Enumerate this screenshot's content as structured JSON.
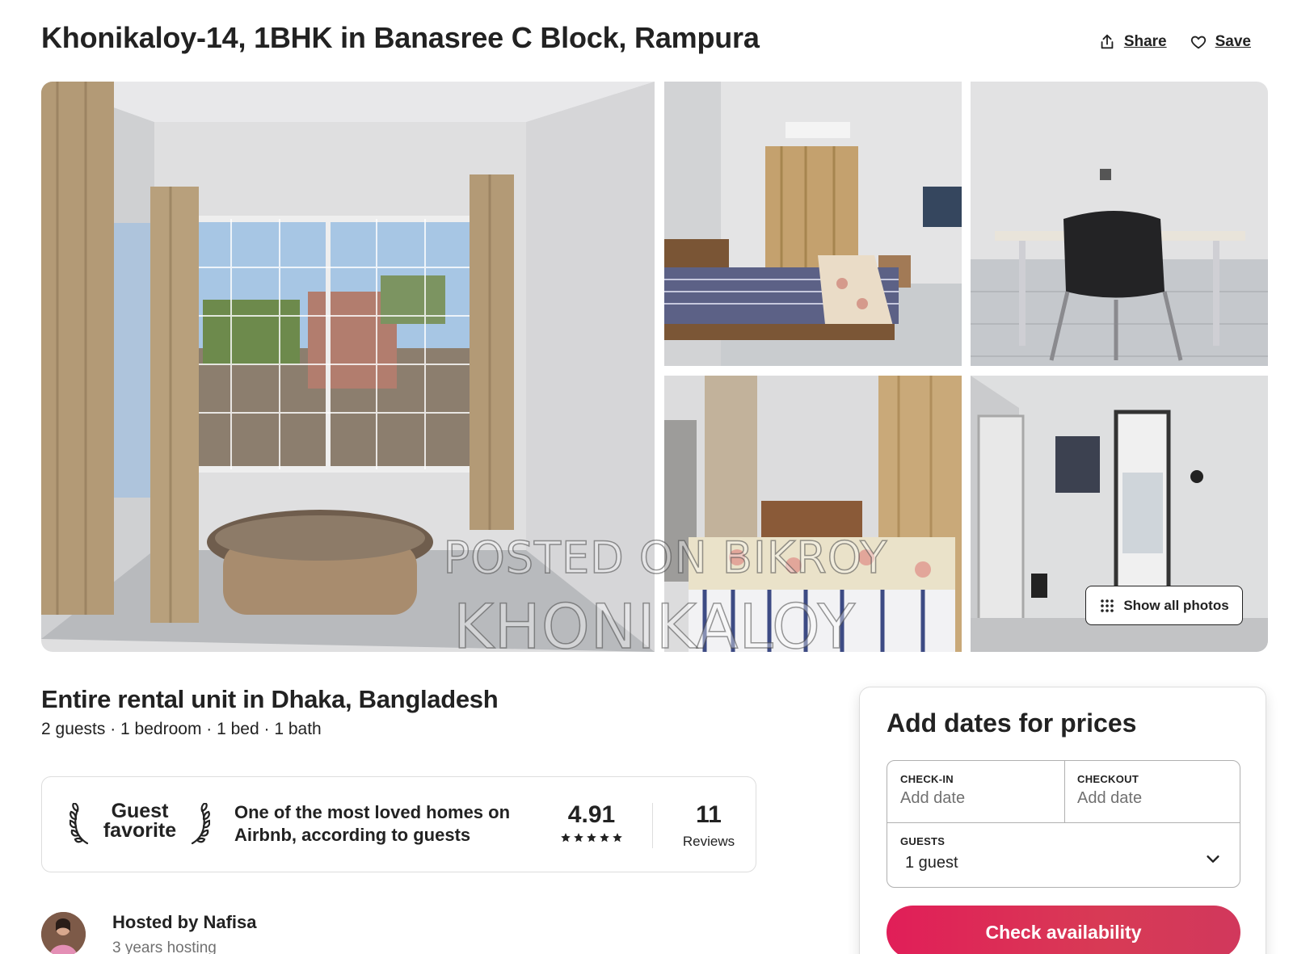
{
  "header": {
    "title": "Khonikaloy-14, 1BHK in Banasree C Block, Rampura",
    "share_label": "Share",
    "save_label": "Save"
  },
  "gallery": {
    "photos": [
      "living-room-window",
      "bedroom-curtains",
      "desk-chair",
      "bedroom-bed",
      "hallway"
    ],
    "watermark_line1": "POSTED ON BIKROY",
    "watermark_line2": "KHONIKALOY",
    "show_all_label": "Show all photos"
  },
  "listing": {
    "title": "Entire rental unit in Dhaka, Bangladesh",
    "details": "2 guests · 1 bedroom · 1 bed · 1 bath"
  },
  "guest_favorite": {
    "badge_line1": "Guest",
    "badge_line2": "favorite",
    "description": "One of the most loved homes on Airbnb, according to guests",
    "rating": "4.91",
    "stars": 5,
    "reviews_count": "11",
    "reviews_label": "Reviews"
  },
  "host": {
    "name": "Hosted by Nafisa",
    "tenure": "3 years hosting"
  },
  "booking": {
    "title": "Add dates for prices",
    "checkin_label": "CHECK-IN",
    "checkin_value": "Add date",
    "checkout_label": "CHECKOUT",
    "checkout_value": "Add date",
    "guests_label": "GUESTS",
    "guests_value": "1 guest",
    "cta_label": "Check availability",
    "cta_color": "#E11E58"
  }
}
